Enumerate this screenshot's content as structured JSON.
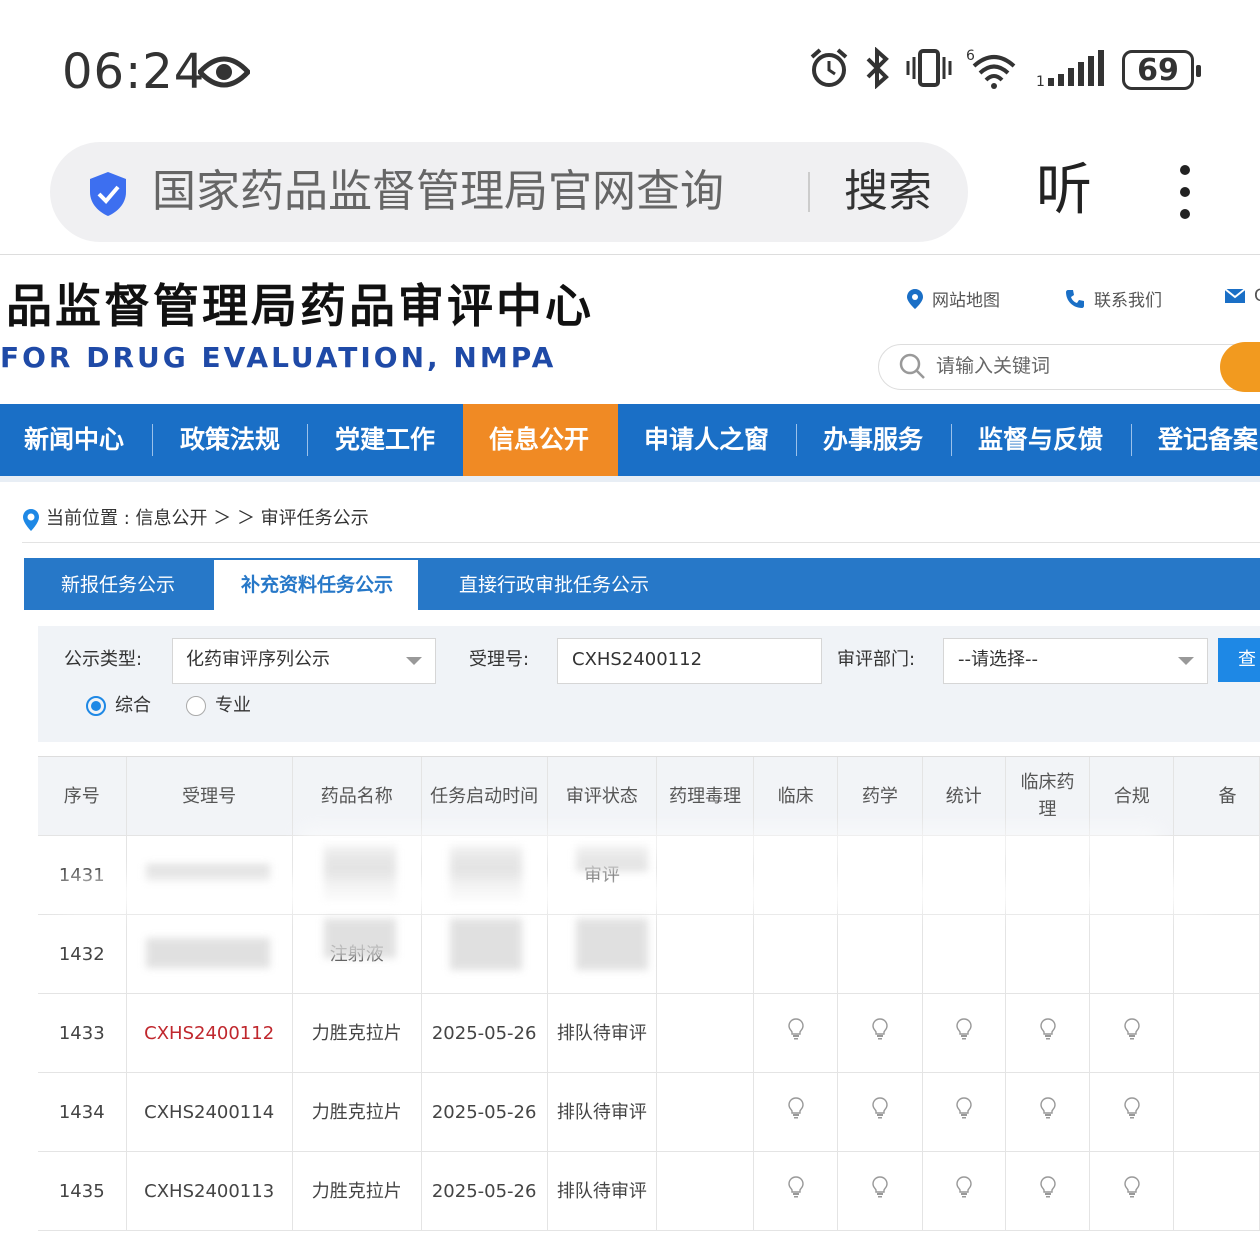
{
  "status_bar": {
    "time": "06:24",
    "battery": "69",
    "icons": [
      "eye-icon",
      "alarm-icon",
      "bluetooth-icon",
      "vibrate-icon",
      "wifi-icon",
      "signal-icon",
      "battery-icon"
    ]
  },
  "browser": {
    "query": "国家药品监督管理局官网查询",
    "search_label": "搜索",
    "listen_label": "听"
  },
  "site": {
    "title": "品监督管理局药品审评中心",
    "subtitle": "FOR DRUG EVALUATION, NMPA",
    "sitemap": "网站地图",
    "contact": "联系我们",
    "mail": "C",
    "search_placeholder": "请输入关键词"
  },
  "nav": {
    "items": [
      "新闻中心",
      "政策法规",
      "党建工作",
      "信息公开",
      "申请人之窗",
      "办事服务",
      "监督与反馈",
      "登记备案"
    ],
    "active_index": 3
  },
  "breadcrumb": {
    "text": "当前位置 : 信息公开 ＞ ＞ 审评任务公示"
  },
  "tabs": {
    "items": [
      "新报任务公示",
      "补充资料任务公示",
      "直接行政审批任务公示"
    ],
    "active_index": 1
  },
  "filter": {
    "type_label": "公示类型:",
    "type_value": "化药审评序列公示",
    "acceptance_label": "受理号:",
    "acceptance_value": "CXHS2400112",
    "dept_label": "审评部门:",
    "dept_value": "--请选择--",
    "query_label": "查",
    "radio_options": [
      "综合",
      "专业"
    ],
    "radio_selected": 0
  },
  "table": {
    "headers": [
      "序号",
      "受理号",
      "药品名称",
      "任务启动时间",
      "审评状态",
      "药理毒理",
      "临床",
      "药学",
      "统计",
      "临床药理",
      "合规",
      "备"
    ],
    "rows": [
      {
        "no": "1431",
        "id": "",
        "name": "",
        "date": "",
        "status": "审评",
        "bulbs": [],
        "blurred": true
      },
      {
        "no": "1432",
        "id": "",
        "name": "注射液",
        "date": "",
        "status": "",
        "bulbs": [],
        "blurred": true
      },
      {
        "no": "1433",
        "id": "CXHS2400112",
        "name": "力胜克拉片",
        "date": "2025-05-26",
        "status": "排队待审评",
        "bulbs": [
          1,
          1,
          1,
          1,
          1
        ],
        "highlight": true
      },
      {
        "no": "1434",
        "id": "CXHS2400114",
        "name": "力胜克拉片",
        "date": "2025-05-26",
        "status": "排队待审评",
        "bulbs": [
          1,
          1,
          1,
          1,
          1
        ]
      },
      {
        "no": "1435",
        "id": "CXHS2400113",
        "name": "力胜克拉片",
        "date": "2025-05-26",
        "status": "排队待审评",
        "bulbs": [
          1,
          1,
          1,
          1,
          1
        ]
      }
    ]
  },
  "colors": {
    "nav_blue": "#1a6fc6",
    "nav_active": "#f08a24",
    "tab_blue": "#2778c8",
    "highlight_red": "#c0272d"
  }
}
